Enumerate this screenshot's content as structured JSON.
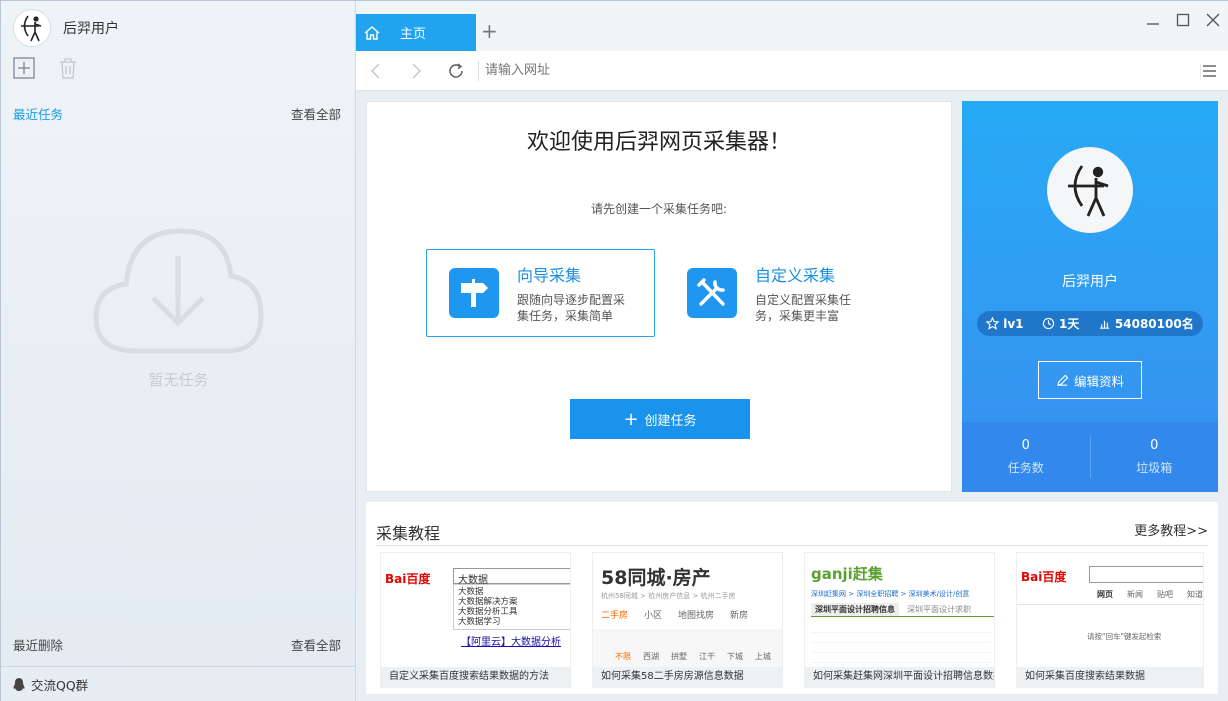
{
  "sidebar": {
    "username": "后羿用户",
    "recent_tasks": "最近任务",
    "view_all": "查看全部",
    "empty_text": "暂无任务",
    "recent_deleted": "最近删除",
    "view_all_deleted": "查看全部",
    "qq_group": "交流QQ群"
  },
  "tabs": {
    "home_label": "主页"
  },
  "address": {
    "placeholder": "请输入网址"
  },
  "welcome": {
    "title": "欢迎使用后羿网页采集器！",
    "subtitle": "请先创建一个采集任务吧:",
    "wizard": {
      "title": "向导采集",
      "desc": "跟随向导逐步配置采集任务，采集简单"
    },
    "custom": {
      "title": "自定义采集",
      "desc": "自定义配置采集任务，采集更丰富"
    },
    "create_button": "创建任务"
  },
  "profile": {
    "name": "后羿用户",
    "level": "lv1",
    "days": "1天",
    "rank": "54080100名",
    "edit_button": "编辑资料",
    "task_count": "0",
    "task_label": "任务数",
    "trash_count": "0",
    "trash_label": "垃圾箱"
  },
  "tutorial": {
    "title": "采集教程",
    "more": "更多教程>>",
    "items": [
      {
        "caption": "自定义采集百度搜索结果数据的方法",
        "logo": "Bai百度",
        "search_text": "大数据",
        "suggestions": [
          "大数据",
          "大数据解决方案",
          "大数据分析工具",
          "大数据学习"
        ],
        "ad": "【阿里云】大数据分析"
      },
      {
        "caption": "如何采集58二手房房源信息数据",
        "logo": "58同城·房产",
        "crumb": "杭州58同城 > 杭州房产信息 > 杭州二手房",
        "nav": [
          "二手房",
          "小区",
          "地图找房",
          "新房"
        ],
        "filters": [
          "不限",
          "西湖",
          "拱墅",
          "江干",
          "下城",
          "上城"
        ]
      },
      {
        "caption": "如何采集赶集网深圳平面设计招聘信息数据",
        "logo": "ganji赶集",
        "crumb": "深圳赶集网 > 深圳全职招聘 > 深圳美术/设计/创意",
        "tab": "深圳平面设计招聘信息",
        "tab2": "深圳平面设计求职"
      },
      {
        "caption": "如何采集百度搜索结果数据",
        "logo": "Bai百度",
        "nav": [
          "网页",
          "新闻",
          "贴吧",
          "知道"
        ],
        "hint": "请按\"回车\"键发起检索"
      }
    ]
  }
}
